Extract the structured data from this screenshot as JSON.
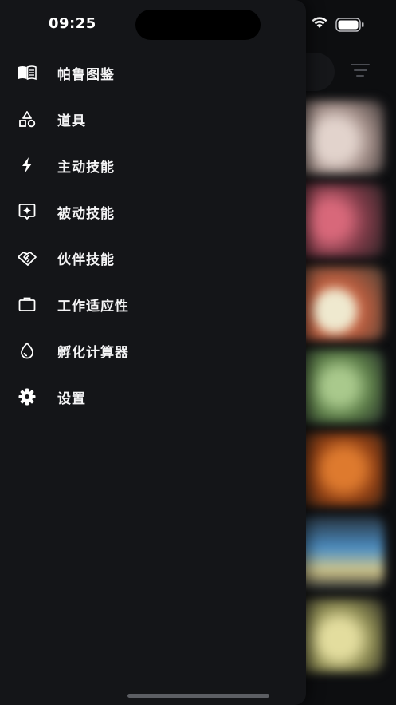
{
  "status_bar": {
    "time": "09:25"
  },
  "menu": {
    "items": [
      {
        "label": "帕鲁图鉴",
        "icon": "book-icon"
      },
      {
        "label": "道具",
        "icon": "shapes-icon"
      },
      {
        "label": "主动技能",
        "icon": "lightning-icon"
      },
      {
        "label": "被动技能",
        "icon": "sparkle-box-icon"
      },
      {
        "label": "伙伴技能",
        "icon": "handshake-icon"
      },
      {
        "label": "工作适应性",
        "icon": "briefcase-icon"
      },
      {
        "label": "孵化计算器",
        "icon": "egg-drop-icon"
      },
      {
        "label": "设置",
        "icon": "gear-icon"
      }
    ]
  },
  "background_cards": {
    "colors": [
      "#d9c9c3",
      "#c9566a",
      "#e8e3c8",
      "#7fae6a",
      "#c8621e",
      "#5d9fce",
      "#d6d29a"
    ]
  },
  "colors": {
    "drawer_bg": "#141518",
    "page_bg": "#0d0e10",
    "text": "#f4f4f5"
  }
}
